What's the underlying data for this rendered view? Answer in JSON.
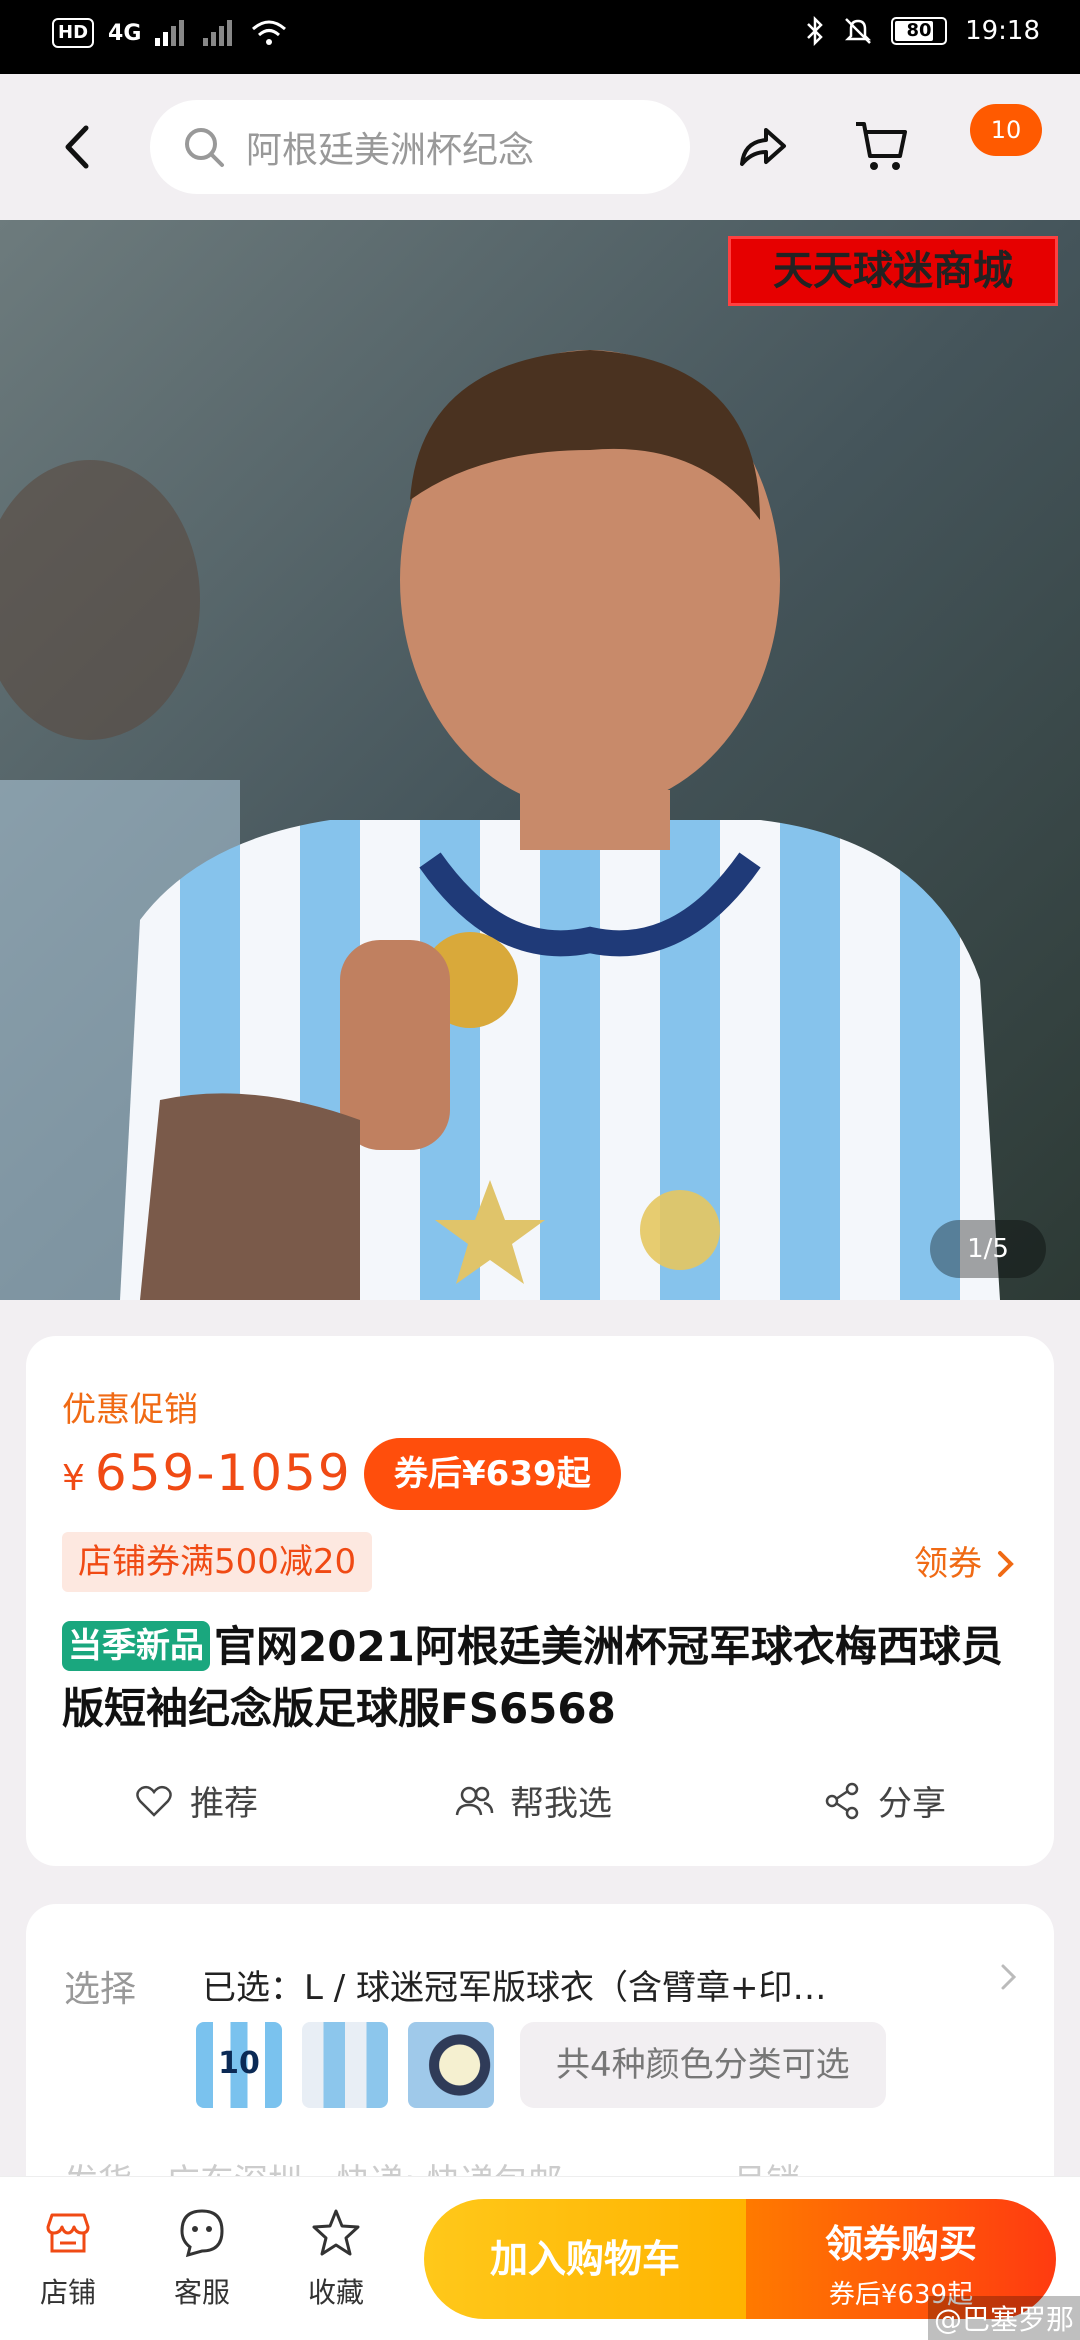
{
  "status_bar": {
    "left_indicators": [
      "HD",
      "4G"
    ],
    "battery": "80",
    "battery_level_pct": 80,
    "time": "19:18"
  },
  "nav": {
    "search_text": "阿根廷美洲杯纪念",
    "cart_badge": "10"
  },
  "hero": {
    "watermark": "天天球迷商城",
    "image_counter": "1/5"
  },
  "product": {
    "promo_label": "优惠促销",
    "currency": "¥",
    "price_range": "659-1059",
    "after_coupon": "券后¥639起",
    "store_coupon": "店铺券满500减20",
    "get_coupon": "领券",
    "new_tag": "当季新品",
    "title": "官网2021阿根廷美洲杯冠军球衣梅西球员版短袖纪念版足球服FS6568",
    "actions": {
      "recommend": "推荐",
      "help_choose": "帮我选",
      "share": "分享"
    }
  },
  "selection": {
    "label": "选择",
    "value": "已选：L / 球迷冠军版球衣（含臂章+印…",
    "thumb1_number": "10",
    "more_colors": "共4种颜色分类可选",
    "shipping_row": "发货　广东深圳　快递: 快递包邮　　　　　月销"
  },
  "bottom_bar": {
    "store": "店铺",
    "service": "客服",
    "favorite": "收藏",
    "add_to_cart": "加入购物车",
    "buy_main": "领券购买",
    "buy_sub": "券后¥639起"
  },
  "corner_watermark": "@巴塞罗那",
  "colors": {
    "accent_orange": "#f04a14",
    "badge_orange": "#ff5a00",
    "new_tag_green": "#1aa77e",
    "cart_button_yellow": "#ffc81a",
    "buy_button_orange": "#ff3b10"
  }
}
